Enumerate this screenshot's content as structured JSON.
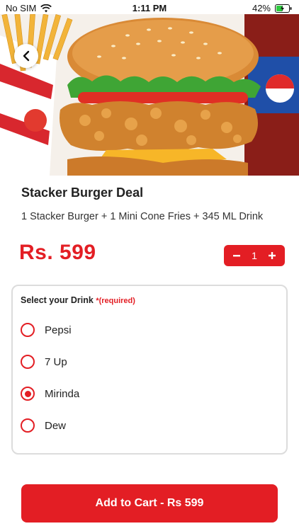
{
  "status_bar": {
    "carrier": "No SIM",
    "time": "1:11 PM",
    "battery": "42%",
    "icons": [
      "wifi-icon",
      "battery-charging-icon"
    ]
  },
  "hero": {
    "image": "stacker-burger-deal-photo",
    "back_icon": "chevron-left-icon"
  },
  "product": {
    "title": "Stacker Burger Deal",
    "description": "1 Stacker Burger + 1 Mini Cone Fries  + 345 ML Drink",
    "price": "Rs. 599"
  },
  "quantity": {
    "value": "1",
    "minus_icon": "minus-icon",
    "plus_icon": "plus-icon"
  },
  "drink_select": {
    "title": "Select your Drink",
    "required": "*(required)",
    "options": [
      {
        "label": "Pepsi",
        "selected": false
      },
      {
        "label": "7 Up",
        "selected": false
      },
      {
        "label": "Mirinda",
        "selected": true
      },
      {
        "label": "Dew",
        "selected": false
      }
    ]
  },
  "cart_button": {
    "label": "Add to Cart - Rs 599"
  },
  "colors": {
    "accent": "#e31e24",
    "text": "#222222",
    "border": "#dcdcdc"
  }
}
